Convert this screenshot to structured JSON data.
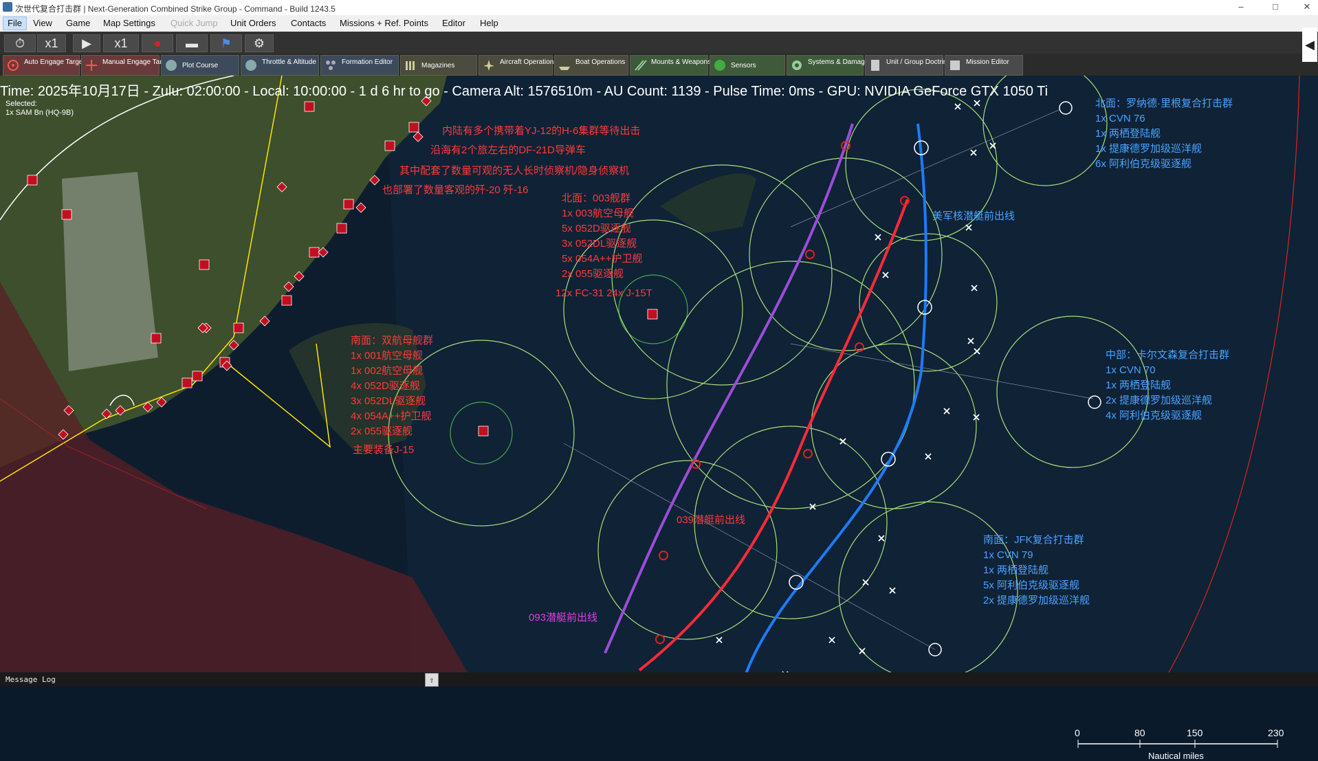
{
  "window": {
    "title": "次世代复合打击群 | Next-Generation Combined Strike Group - Command - Build 1243.5",
    "minimize": "–",
    "maximize": "□",
    "close": "✕"
  },
  "menu": [
    "File",
    "View",
    "Game",
    "Map Settings",
    "Quick Jump",
    "Unit Orders",
    "Contacts",
    "Missions + Ref. Points",
    "Editor",
    "Help"
  ],
  "toolbar1": {
    "speed1": "x1",
    "speed2": "x1"
  },
  "toolbar2": [
    "Auto Engage Target",
    "Manual Engage Target",
    "Plot Course",
    "Throttle & Altitude",
    "Formation Editor",
    "Magazines",
    "Aircraft Operations",
    "Boat Operations",
    "Mounts & Weapons",
    "Sensors",
    "Systems & Damage",
    "Unit / Group Doctrine",
    "Mission Editor"
  ],
  "status": "Time: 2025年10月17日 - Zulu: 02:00:00 - Local: 10:00:00 - 1 d 6 hr to go -  Camera Alt: 1576510m  - AU Count: 1139 - Pulse Time: 0ms - GPU: NVIDIA GeForce GTX 1050 Ti",
  "selected": {
    "label": "Selected:",
    "unit": "1x SAM Bn (HQ-9B)"
  },
  "annotations_red": {
    "inland": "内陆有多个携带着YJ-12的H-6集群等待出击",
    "coast": "沿海有2个旅左右的DF-21D导弹车",
    "uav": "其中配套了数量可观的无人长时侦察机/隐身侦察机",
    "j20": "也部署了数量客观的歼-20 歼-16",
    "north_title": "北面：003舰群",
    "north_lines": [
      "1x 003航空母舰",
      "5x 052D驱逐舰",
      "3x 052DL驱逐舰",
      "5x 054A++护卫舰",
      "2x 055驱逐舰"
    ],
    "north_air": "12x FC-31 24x J-15T",
    "south_title": "南面：双航母舰群",
    "south_lines": [
      "1x 001航空母舰",
      "1x 002航空母舰",
      "4x 052D驱逐舰",
      "3x 052DL驱逐舰",
      "4x 054A++护卫舰",
      "2x 055驱逐舰"
    ],
    "south_air": "主要装备J-15",
    "sub039": "039潜艇前出线"
  },
  "annotations_magenta": {
    "sub093": "093潜艇前出线"
  },
  "annotations_blue": {
    "us_sub": "美军核潜艇前出线",
    "n_title": "北面：罗纳德·里根复合打击群",
    "n_lines": [
      "1x CVN 76",
      "1x 两栖登陆舰",
      "1x 提康德罗加级巡洋舰",
      "6x 阿利伯克级驱逐舰"
    ],
    "m_title": "中部：卡尔文森复合打击群",
    "m_lines": [
      "1x CVN 70",
      "1x 两栖登陆舰",
      "2x 提康德罗加级巡洋舰",
      "4x 阿利伯克级驱逐舰"
    ],
    "s_title": "南面：JFK复合打击群",
    "s_lines": [
      "1x CVN 79",
      "1x 两栖登陆舰",
      "5x 阿利伯克级驱逐舰",
      "2x 提康德罗加级巡洋舰"
    ]
  },
  "scale": {
    "ticks": [
      "0",
      "80",
      "150",
      "230"
    ],
    "unit": "Nautical miles"
  },
  "message_log": "Message Log",
  "colors": {
    "red_line": "#ff2a3a",
    "purple_line": "#9b4dd8",
    "blue_line": "#1e7bff",
    "range_ring": "#a8e07a",
    "annotation_red": "#ff3a3a",
    "annotation_blue": "#4aa3ff"
  }
}
